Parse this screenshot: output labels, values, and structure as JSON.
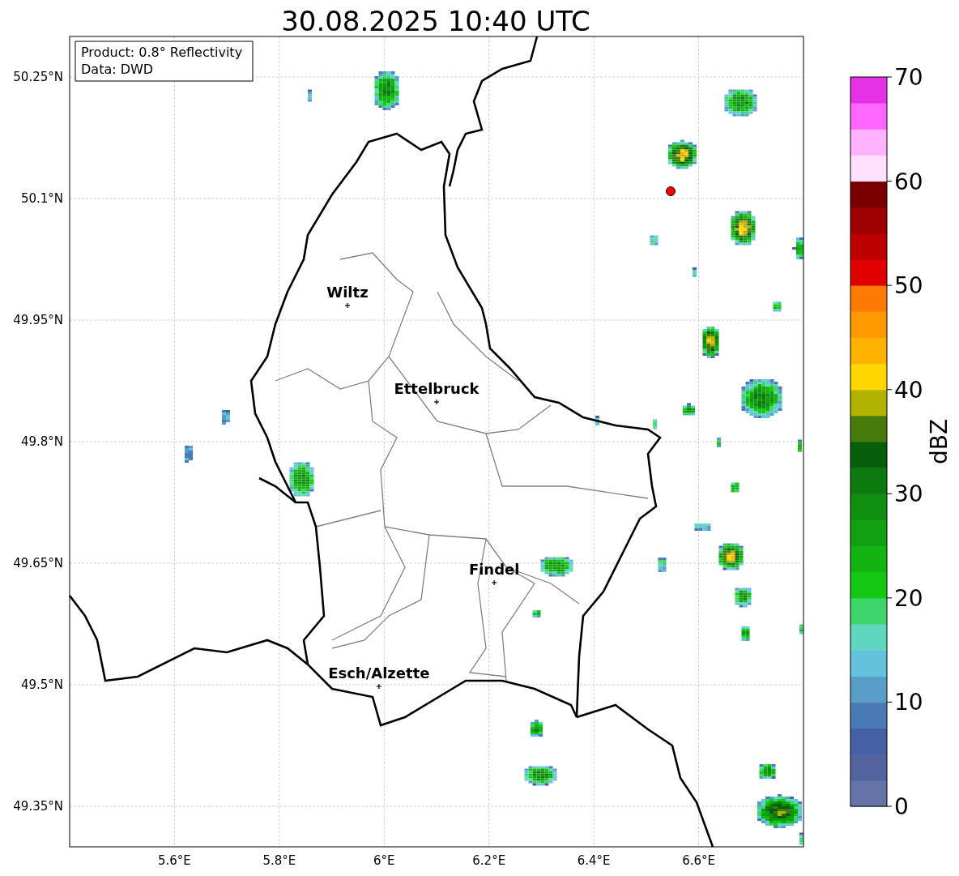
{
  "title": "30.08.2025 10:40 UTC",
  "legend": [
    "Product: 0.8° Reflectivity",
    "Data: DWD"
  ],
  "map": {
    "x_ticks": [
      "5.6°E",
      "5.8°E",
      "6°E",
      "6.2°E",
      "6.4°E",
      "6.6°E"
    ],
    "y_ticks": [
      "50.25°N",
      "50.1°N",
      "49.95°N",
      "49.8°N",
      "49.65°N",
      "49.5°N",
      "49.35°N"
    ],
    "cities": [
      {
        "name": "Wiltz"
      },
      {
        "name": "Ettelbruck"
      },
      {
        "name": "Findel"
      },
      {
        "name": "Esch/Alzette"
      }
    ]
  },
  "colorbar": {
    "label": "dBZ",
    "ticks": [
      "70",
      "60",
      "50",
      "40",
      "30",
      "20",
      "10",
      "0"
    ]
  }
}
